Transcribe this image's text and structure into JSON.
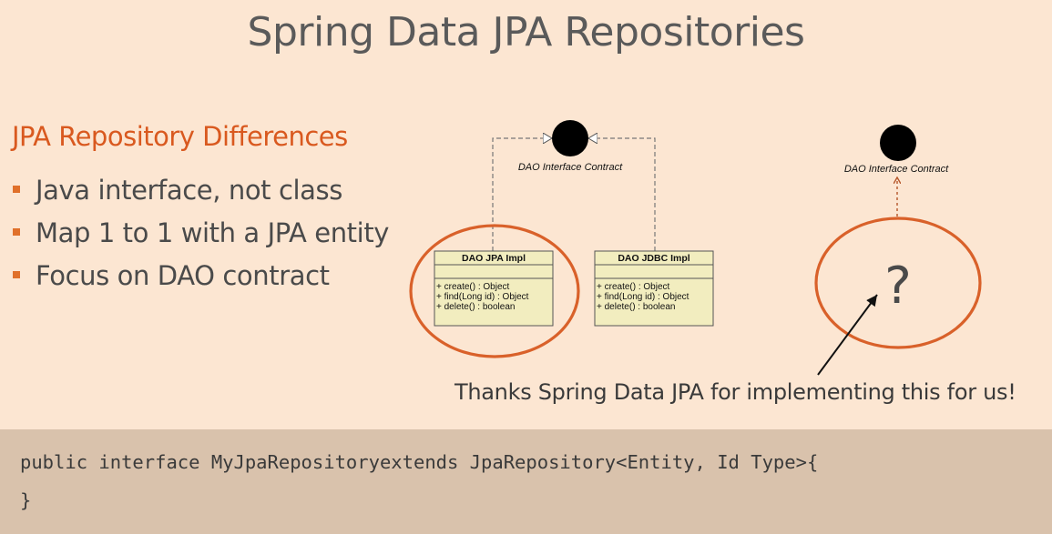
{
  "slide": {
    "title": "Spring Data JPA Repositories",
    "heading": "JPA Repository Differences",
    "bullets": [
      "Java interface, not class",
      "Map 1 to 1 with a JPA entity",
      "Focus on DAO contract"
    ]
  },
  "diagram": {
    "left": {
      "interface_label": "DAO Interface Contract",
      "classes": [
        {
          "name": "DAO JPA Impl",
          "methods": [
            "+ create() : Object",
            "+ find(Long id) : Object",
            "+ delete() : boolean"
          ]
        },
        {
          "name": "DAO JDBC Impl",
          "methods": [
            "+ create() : Object",
            "+ find(Long id) : Object",
            "+ delete() : boolean"
          ]
        }
      ]
    },
    "right": {
      "interface_label": "DAO Interface Contract",
      "unknown_symbol": "?"
    },
    "caption": "Thanks Spring Data JPA for implementing this for us!"
  },
  "code": {
    "line1": "public interface MyJpaRepositoryextends JpaRepository<Entity, Id Type>{",
    "line2": "}"
  },
  "colors": {
    "background": "#fce6d2",
    "accent": "#d9591f",
    "uml_box": "#f2edbf",
    "code_box": "#d9c2ac"
  }
}
